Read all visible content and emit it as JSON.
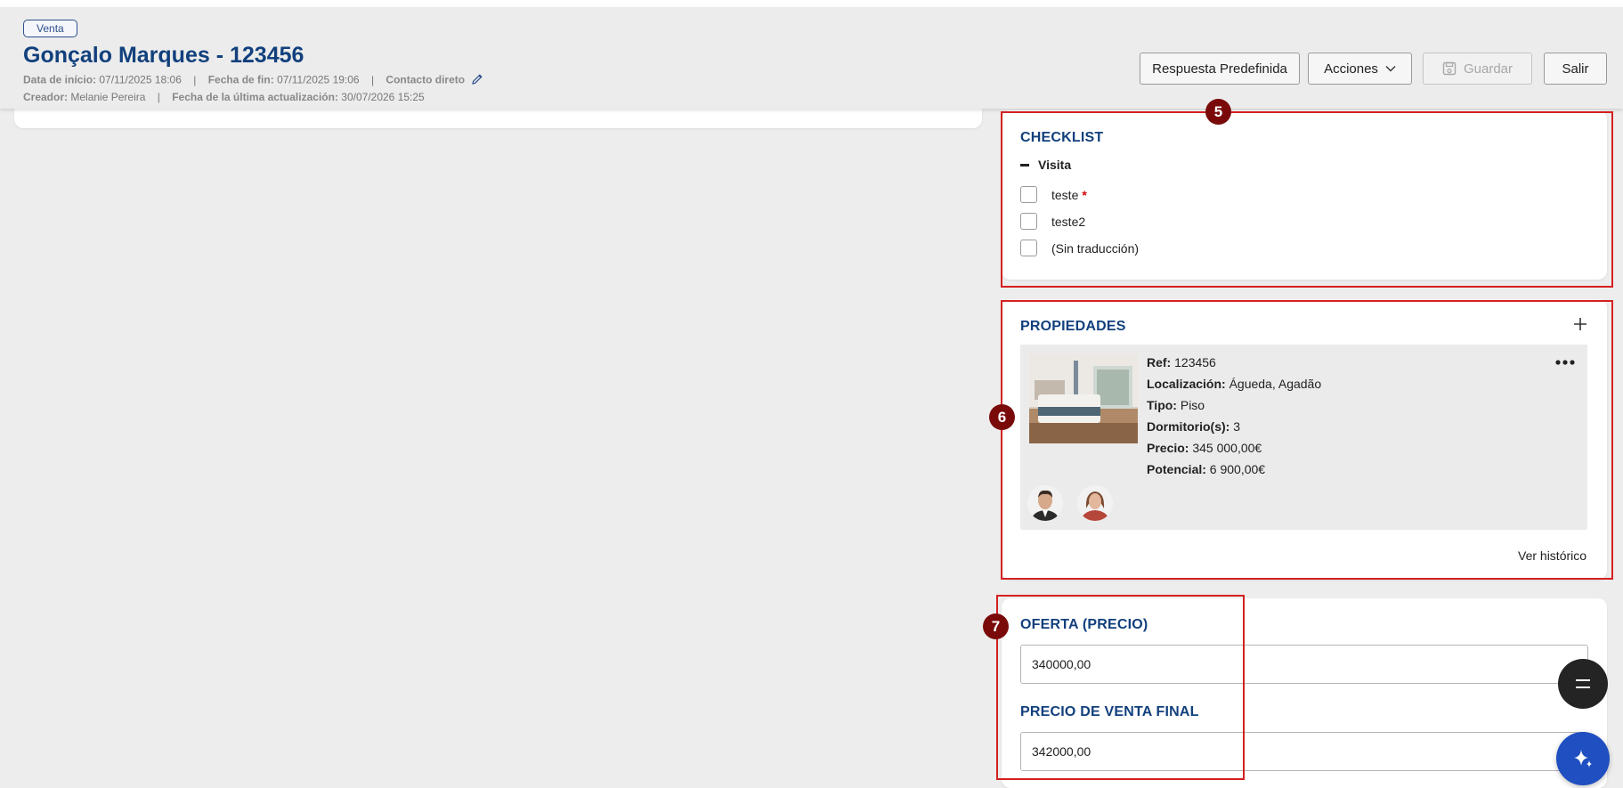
{
  "header": {
    "badge": "Venta",
    "title": "Gonçalo Marques - 123456",
    "start_label": "Data de início:",
    "start_value": "07/11/2025 18:06",
    "end_label": "Fecha de fin:",
    "end_value": "07/11/2025 19:06",
    "contact": "Contacto direto",
    "creator_label": "Creador:",
    "creator_value": "Melanie Pereira",
    "updated_label": "Fecha de la última actualización:",
    "updated_value": "30/07/2026 15:25",
    "separator": "|"
  },
  "toolbar": {
    "predefined": "Respuesta Predefinida",
    "actions": "Acciones",
    "save": "Guardar",
    "exit": "Salir"
  },
  "checklist": {
    "title": "CHECKLIST",
    "group": "Visita",
    "items": [
      {
        "label": "teste",
        "required": "*"
      },
      {
        "label": "teste2"
      },
      {
        "label": "(Sin traducción)"
      }
    ]
  },
  "properties": {
    "title": "PROPIEDADES",
    "item": {
      "ref_label": "Ref:",
      "ref": "123456",
      "loc_label": "Localización:",
      "loc": "Águeda, Agadão",
      "type_label": "Tipo:",
      "type": "Piso",
      "rooms_label": "Dormitorio(s):",
      "rooms": "3",
      "price_label": "Precio:",
      "price": "345 000,00€",
      "potential_label": "Potencial:",
      "potential": "6 900,00€"
    },
    "history": "Ver histórico"
  },
  "offer": {
    "title": "OFERTA (PRECIO)",
    "value": "340000,00",
    "final_title": "PRECIO DE VENTA FINAL",
    "final_value": "342000,00"
  },
  "markers": [
    "5",
    "6",
    "7"
  ],
  "colors": {
    "accent": "#12407d",
    "annotation": "#d42020",
    "marker": "#7a0a0a",
    "ai_button": "#1f4fc0"
  }
}
